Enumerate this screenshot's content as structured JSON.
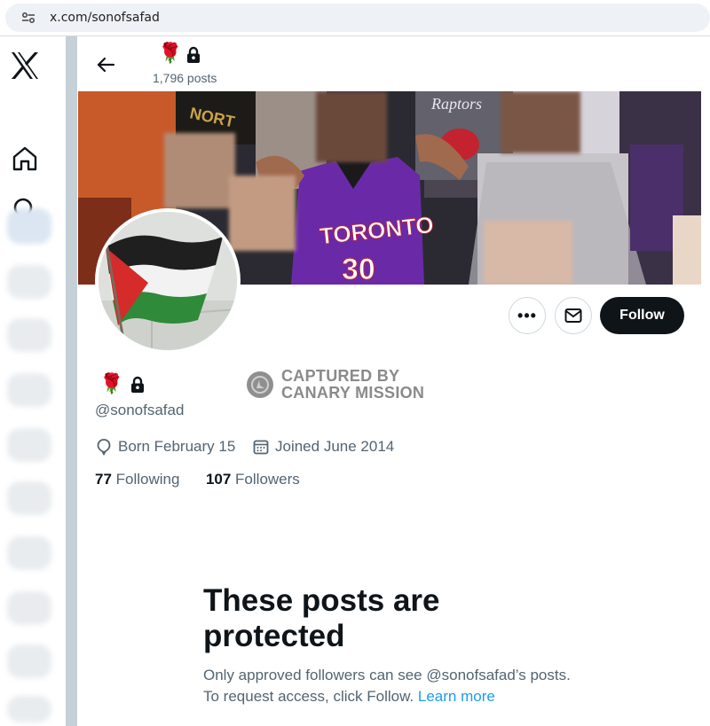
{
  "browser": {
    "url": "x.com/sonofsafad"
  },
  "icons": {
    "site_settings": "tune-icon",
    "logo": "x-logo-icon",
    "home": "home-icon",
    "search": "search-icon",
    "back": "arrow-left-icon",
    "lock": "lock-icon",
    "rose": "rose-emoji",
    "more": "more-dots-icon",
    "message": "envelope-icon",
    "birthday": "balloon-icon",
    "calendar": "calendar-icon"
  },
  "header": {
    "name_emoji": "🌹",
    "posts_count": "1,796 posts"
  },
  "profile": {
    "name_emoji": "🌹",
    "handle": "@sonofsafad",
    "born": "Born February 15",
    "joined": "Joined June 2014",
    "following_count": "77",
    "following_label": "Following",
    "followers_count": "107",
    "followers_label": "Followers",
    "banner_jersey_team": "TORONTO",
    "banner_jersey_number": "30",
    "banner_sign": "Raptors"
  },
  "actions": {
    "more_label": "•••",
    "follow_label": "Follow"
  },
  "watermark": {
    "line1": "CAPTURED BY",
    "line2": "CANARY MISSION"
  },
  "protected": {
    "title": "These posts are protected",
    "description": "Only approved followers can see @sonofsafad’s posts. To request access, click Follow. ",
    "link": "Learn more"
  },
  "colors": {
    "follow_button_bg": "#0f1419",
    "link": "#1d9bf0",
    "secondary_text": "#536471",
    "jersey_purple": "#6a2aa8",
    "sidebar_strip": "#c6d0d8"
  }
}
